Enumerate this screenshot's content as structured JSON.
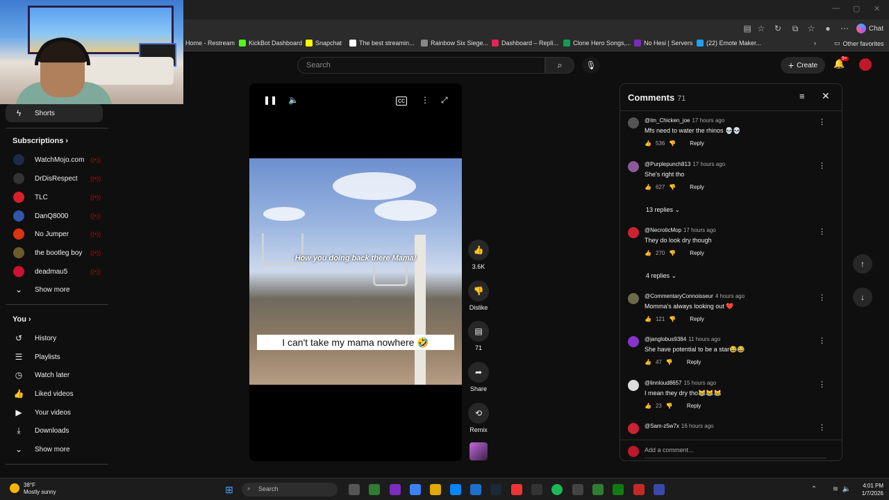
{
  "browser": {
    "chat_label": "Chat",
    "bookmarks": [
      {
        "label": "Home - Restream",
        "color": "#2a6cf6"
      },
      {
        "label": "KickBot Dashboard",
        "color": "#53fc18"
      },
      {
        "label": "Snapchat",
        "color": "#fffc00"
      },
      {
        "label": "The best streamin...",
        "color": "#ffffff"
      },
      {
        "label": "Rainbow Six Siege...",
        "color": "#888888"
      },
      {
        "label": "Dashboard – Repli...",
        "color": "#e0245e"
      },
      {
        "label": "Clone Hero Songs,...",
        "color": "#0f9d58"
      },
      {
        "label": "No Hesi | Servers",
        "color": "#7b2cbf"
      },
      {
        "label": "(22) Emote Maker...",
        "color": "#1da1f2"
      }
    ],
    "other_favorites": "Other favorites"
  },
  "header": {
    "search_placeholder": "Search",
    "create_label": "Create",
    "notif_count": "9+"
  },
  "sidebar": {
    "shorts_label": "Shorts",
    "subscriptions_heading": "Subscriptions",
    "subscriptions": [
      {
        "label": "WatchMojo.com",
        "color": "#1e2a4a"
      },
      {
        "label": "DrDisRespect",
        "color": "#333333"
      },
      {
        "label": "TLC",
        "color": "#d8202c"
      },
      {
        "label": "DanQ8000",
        "color": "#3355aa"
      },
      {
        "label": "No Jumper",
        "color": "#dd3311"
      },
      {
        "label": "the bootleg boy",
        "color": "#6b5b2e"
      },
      {
        "label": "deadmau5",
        "color": "#cc1133"
      }
    ],
    "show_more": "Show more",
    "you_heading": "You",
    "you_items": [
      {
        "label": "History",
        "icon": "history-icon"
      },
      {
        "label": "Playlists",
        "icon": "playlists-icon"
      },
      {
        "label": "Watch later",
        "icon": "watch-later-icon"
      },
      {
        "label": "Liked videos",
        "icon": "like-icon"
      },
      {
        "label": "Your videos",
        "icon": "your-videos-icon"
      },
      {
        "label": "Downloads",
        "icon": "download-icon"
      }
    ],
    "show_more_2": "Show more"
  },
  "video": {
    "caption_top": "How you doing back there Mama!",
    "caption_bottom": "I can't take my mama nowhere 🤣"
  },
  "actions": {
    "like_count": "3.6K",
    "dislike_label": "Dislike",
    "comments_count": "71",
    "share_label": "Share",
    "remix_label": "Remix"
  },
  "comments": {
    "title": "Comments",
    "count": "71",
    "items": [
      {
        "author": "@Im_Chicken_joe",
        "ago": "17 hours ago",
        "text": "Mfs need to water the rhinos 💀💀",
        "likes": "536",
        "avatar": "#555555"
      },
      {
        "author": "@Purplepunch813",
        "ago": "17 hours ago",
        "text": "She's right tho",
        "likes": "627",
        "avatar": "#8a5a9a"
      },
      {
        "author": "@NecroticMop",
        "ago": "17 hours ago",
        "text": "They do look dry though",
        "likes": "270",
        "avatar": "#cc2233"
      },
      {
        "author": "@CommentaryConnoisseur",
        "ago": "4 hours ago",
        "text": "Momma's always looking out ❤️",
        "likes": "121",
        "avatar": "#6b6b4a"
      },
      {
        "author": "@janglobus9384",
        "ago": "11 hours ago",
        "text": "She have potential to be a star😂😂",
        "likes": "47",
        "avatar": "#8833cc"
      },
      {
        "author": "@linnloud8657",
        "ago": "15 hours ago",
        "text": "I mean they dry tho😹😹😹",
        "likes": "23",
        "avatar": "#dddddd"
      },
      {
        "author": "@Sam-z5w7x",
        "ago": "16 hours ago",
        "text": "",
        "likes": "",
        "avatar": "#cc2233"
      }
    ],
    "reply_label": "Reply",
    "replies_1": "13 replies",
    "replies_2": "4 replies",
    "add_placeholder": "Add a comment..."
  },
  "taskbar": {
    "temp": "38°F",
    "weather": "Mostly sunny",
    "search": "Search",
    "time": "4:01 PM",
    "date": "1/7/2026"
  }
}
